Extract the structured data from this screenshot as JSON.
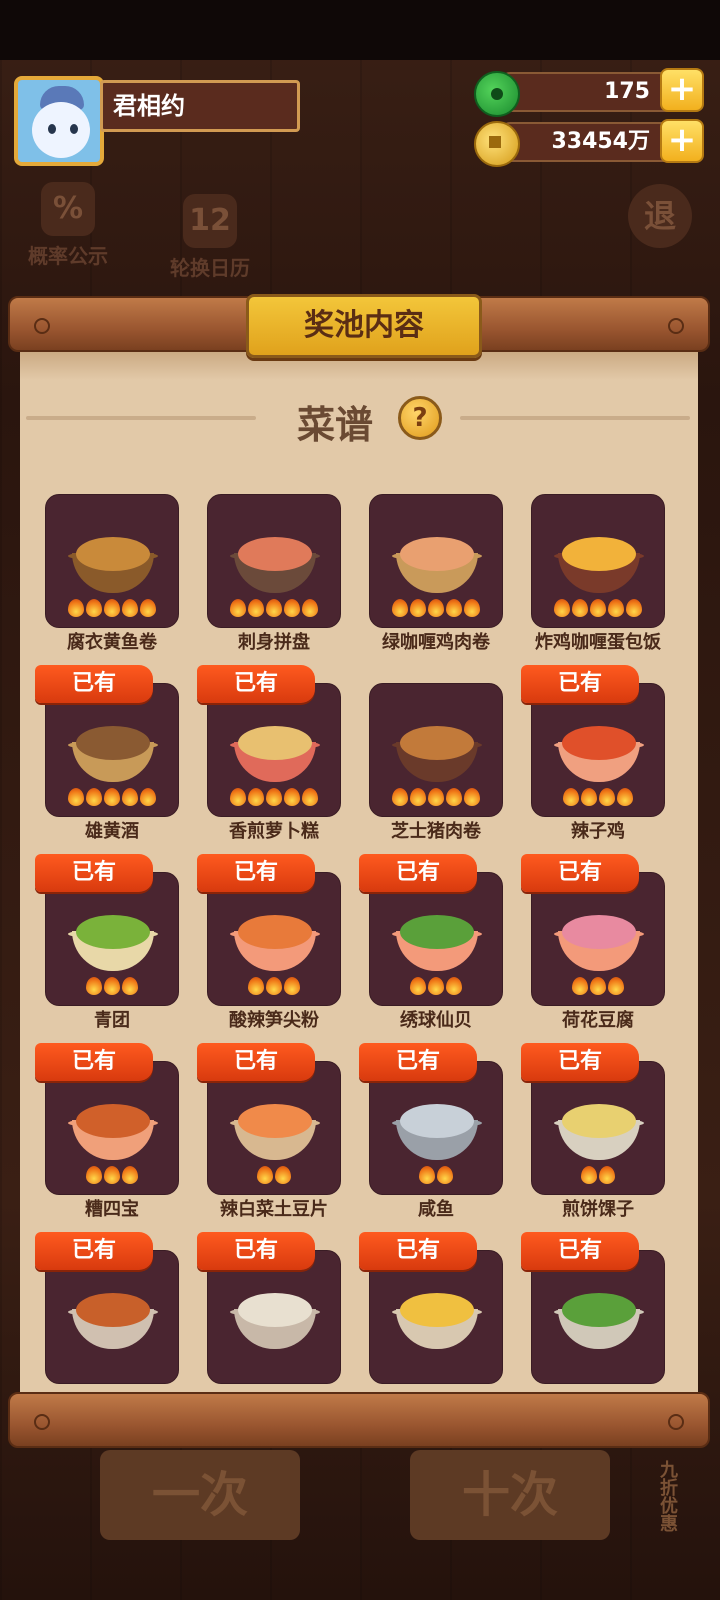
{
  "player": {
    "name": "君相约"
  },
  "currency": {
    "jade": "175",
    "coins": "33454万"
  },
  "tools": {
    "rate_label": "概率公示",
    "calendar_label": "轮换日历",
    "exit_label": "退",
    "calendar_icon_text": "12"
  },
  "background_buttons": {
    "one_label": "一次",
    "ten_label": "十次",
    "discount_label": "九折优惠"
  },
  "panel": {
    "title": "奖池内容",
    "section_title": "菜谱",
    "help_symbol": "?",
    "owned_label": "已有"
  },
  "dishes": [
    {
      "name": "腐衣黄鱼卷",
      "stars": 5,
      "owned": false,
      "food_color": "#c98a3a",
      "bowl_color": "#8a5a2a"
    },
    {
      "name": "刺身拼盘",
      "stars": 5,
      "owned": false,
      "food_color": "#e07a5a",
      "bowl_color": "#6b4a3a"
    },
    {
      "name": "绿咖喱鸡肉卷",
      "stars": 5,
      "owned": false,
      "food_color": "#e9a070",
      "bowl_color": "#c99a5a"
    },
    {
      "name": "炸鸡咖喱蛋包饭",
      "stars": 5,
      "owned": false,
      "food_color": "#f2b23a",
      "bowl_color": "#7a3a2a"
    },
    {
      "name": "雄黄酒",
      "stars": 5,
      "owned": true,
      "food_color": "#8a5a32",
      "bowl_color": "#c89a58"
    },
    {
      "name": "香煎萝卜糕",
      "stars": 5,
      "owned": true,
      "food_color": "#e8c070",
      "bowl_color": "#e06a5a"
    },
    {
      "name": "芝士猪肉卷",
      "stars": 5,
      "owned": false,
      "food_color": "#c27a3a",
      "bowl_color": "#6a3a2a"
    },
    {
      "name": "辣子鸡",
      "stars": 4,
      "owned": true,
      "food_color": "#e0502a",
      "bowl_color": "#f0a080"
    },
    {
      "name": "青团",
      "stars": 3,
      "owned": true,
      "food_color": "#7ab23a",
      "bowl_color": "#e8d8a8"
    },
    {
      "name": "酸辣笋尖粉",
      "stars": 3,
      "owned": true,
      "food_color": "#e87a3a",
      "bowl_color": "#f39a7a"
    },
    {
      "name": "绣球仙贝",
      "stars": 3,
      "owned": true,
      "food_color": "#5aa03a",
      "bowl_color": "#f39a7a"
    },
    {
      "name": "荷花豆腐",
      "stars": 3,
      "owned": true,
      "food_color": "#e88aa0",
      "bowl_color": "#f39a7a"
    },
    {
      "name": "糟四宝",
      "stars": 3,
      "owned": true,
      "food_color": "#d0602a",
      "bowl_color": "#f0a07a"
    },
    {
      "name": "辣白菜土豆片",
      "stars": 2,
      "owned": true,
      "food_color": "#f08a4a",
      "bowl_color": "#d8b890"
    },
    {
      "name": "咸鱼",
      "stars": 2,
      "owned": true,
      "food_color": "#c8d0d8",
      "bowl_color": "#9aa0a8"
    },
    {
      "name": "煎饼馃子",
      "stars": 2,
      "owned": true,
      "food_color": "#e8d070",
      "bowl_color": "#d8d0c0"
    },
    {
      "name": "",
      "stars": 0,
      "owned": true,
      "food_color": "#c8602a",
      "bowl_color": "#d0c0b0"
    },
    {
      "name": "",
      "stars": 0,
      "owned": true,
      "food_color": "#e8e0d0",
      "bowl_color": "#c8b8a8"
    },
    {
      "name": "",
      "stars": 0,
      "owned": true,
      "food_color": "#f0c040",
      "bowl_color": "#d8c8b0"
    },
    {
      "name": "",
      "stars": 0,
      "owned": true,
      "food_color": "#5aa03a",
      "bowl_color": "#d0c8b8"
    }
  ],
  "colors": {
    "panel_paper": "#e2c9a8",
    "tile": "#4a2530",
    "owned_badge": "#e8481a",
    "title_plate": "#f3c63a"
  }
}
